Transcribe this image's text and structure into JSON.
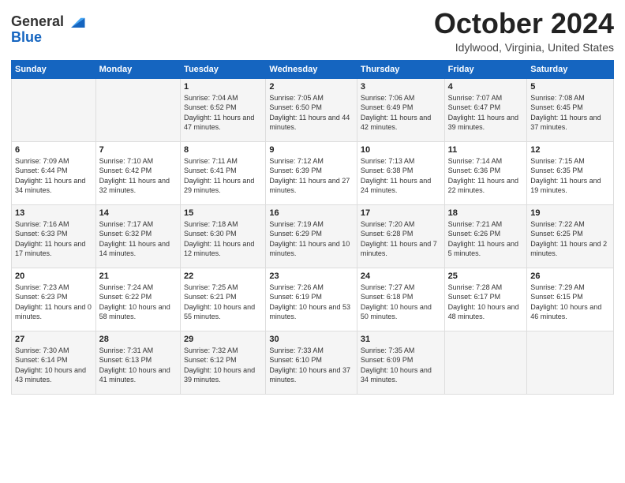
{
  "logo": {
    "general": "General",
    "blue": "Blue"
  },
  "title": "October 2024",
  "location": "Idylwood, Virginia, United States",
  "days_of_week": [
    "Sunday",
    "Monday",
    "Tuesday",
    "Wednesday",
    "Thursday",
    "Friday",
    "Saturday"
  ],
  "weeks": [
    [
      {
        "day": "",
        "info": ""
      },
      {
        "day": "",
        "info": ""
      },
      {
        "day": "1",
        "info": "Sunrise: 7:04 AM\nSunset: 6:52 PM\nDaylight: 11 hours and 47 minutes."
      },
      {
        "day": "2",
        "info": "Sunrise: 7:05 AM\nSunset: 6:50 PM\nDaylight: 11 hours and 44 minutes."
      },
      {
        "day": "3",
        "info": "Sunrise: 7:06 AM\nSunset: 6:49 PM\nDaylight: 11 hours and 42 minutes."
      },
      {
        "day": "4",
        "info": "Sunrise: 7:07 AM\nSunset: 6:47 PM\nDaylight: 11 hours and 39 minutes."
      },
      {
        "day": "5",
        "info": "Sunrise: 7:08 AM\nSunset: 6:45 PM\nDaylight: 11 hours and 37 minutes."
      }
    ],
    [
      {
        "day": "6",
        "info": "Sunrise: 7:09 AM\nSunset: 6:44 PM\nDaylight: 11 hours and 34 minutes."
      },
      {
        "day": "7",
        "info": "Sunrise: 7:10 AM\nSunset: 6:42 PM\nDaylight: 11 hours and 32 minutes."
      },
      {
        "day": "8",
        "info": "Sunrise: 7:11 AM\nSunset: 6:41 PM\nDaylight: 11 hours and 29 minutes."
      },
      {
        "day": "9",
        "info": "Sunrise: 7:12 AM\nSunset: 6:39 PM\nDaylight: 11 hours and 27 minutes."
      },
      {
        "day": "10",
        "info": "Sunrise: 7:13 AM\nSunset: 6:38 PM\nDaylight: 11 hours and 24 minutes."
      },
      {
        "day": "11",
        "info": "Sunrise: 7:14 AM\nSunset: 6:36 PM\nDaylight: 11 hours and 22 minutes."
      },
      {
        "day": "12",
        "info": "Sunrise: 7:15 AM\nSunset: 6:35 PM\nDaylight: 11 hours and 19 minutes."
      }
    ],
    [
      {
        "day": "13",
        "info": "Sunrise: 7:16 AM\nSunset: 6:33 PM\nDaylight: 11 hours and 17 minutes."
      },
      {
        "day": "14",
        "info": "Sunrise: 7:17 AM\nSunset: 6:32 PM\nDaylight: 11 hours and 14 minutes."
      },
      {
        "day": "15",
        "info": "Sunrise: 7:18 AM\nSunset: 6:30 PM\nDaylight: 11 hours and 12 minutes."
      },
      {
        "day": "16",
        "info": "Sunrise: 7:19 AM\nSunset: 6:29 PM\nDaylight: 11 hours and 10 minutes."
      },
      {
        "day": "17",
        "info": "Sunrise: 7:20 AM\nSunset: 6:28 PM\nDaylight: 11 hours and 7 minutes."
      },
      {
        "day": "18",
        "info": "Sunrise: 7:21 AM\nSunset: 6:26 PM\nDaylight: 11 hours and 5 minutes."
      },
      {
        "day": "19",
        "info": "Sunrise: 7:22 AM\nSunset: 6:25 PM\nDaylight: 11 hours and 2 minutes."
      }
    ],
    [
      {
        "day": "20",
        "info": "Sunrise: 7:23 AM\nSunset: 6:23 PM\nDaylight: 11 hours and 0 minutes."
      },
      {
        "day": "21",
        "info": "Sunrise: 7:24 AM\nSunset: 6:22 PM\nDaylight: 10 hours and 58 minutes."
      },
      {
        "day": "22",
        "info": "Sunrise: 7:25 AM\nSunset: 6:21 PM\nDaylight: 10 hours and 55 minutes."
      },
      {
        "day": "23",
        "info": "Sunrise: 7:26 AM\nSunset: 6:19 PM\nDaylight: 10 hours and 53 minutes."
      },
      {
        "day": "24",
        "info": "Sunrise: 7:27 AM\nSunset: 6:18 PM\nDaylight: 10 hours and 50 minutes."
      },
      {
        "day": "25",
        "info": "Sunrise: 7:28 AM\nSunset: 6:17 PM\nDaylight: 10 hours and 48 minutes."
      },
      {
        "day": "26",
        "info": "Sunrise: 7:29 AM\nSunset: 6:15 PM\nDaylight: 10 hours and 46 minutes."
      }
    ],
    [
      {
        "day": "27",
        "info": "Sunrise: 7:30 AM\nSunset: 6:14 PM\nDaylight: 10 hours and 43 minutes."
      },
      {
        "day": "28",
        "info": "Sunrise: 7:31 AM\nSunset: 6:13 PM\nDaylight: 10 hours and 41 minutes."
      },
      {
        "day": "29",
        "info": "Sunrise: 7:32 AM\nSunset: 6:12 PM\nDaylight: 10 hours and 39 minutes."
      },
      {
        "day": "30",
        "info": "Sunrise: 7:33 AM\nSunset: 6:10 PM\nDaylight: 10 hours and 37 minutes."
      },
      {
        "day": "31",
        "info": "Sunrise: 7:35 AM\nSunset: 6:09 PM\nDaylight: 10 hours and 34 minutes."
      },
      {
        "day": "",
        "info": ""
      },
      {
        "day": "",
        "info": ""
      }
    ]
  ]
}
